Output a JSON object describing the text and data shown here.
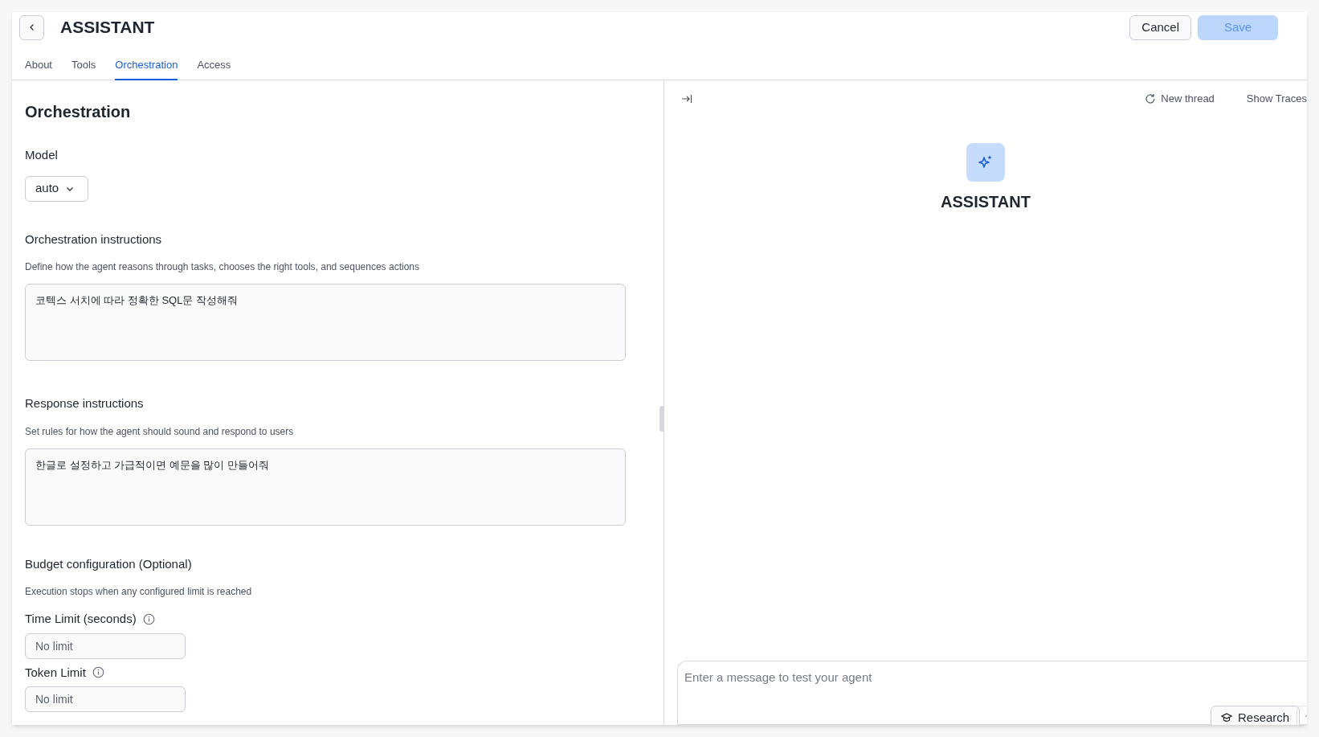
{
  "header": {
    "title": "ASSISTANT",
    "buttons": [
      {
        "label": "Cancel",
        "kind": "secondary",
        "disabled": false
      },
      {
        "label": "Save",
        "kind": "primary",
        "disabled": true
      }
    ]
  },
  "tabs": [
    {
      "label": "About",
      "selected": false
    },
    {
      "label": "Tools",
      "selected": false
    },
    {
      "label": "Orchestration",
      "selected": true
    },
    {
      "label": "Access",
      "selected": false
    }
  ],
  "form": {
    "heading": "Orchestration",
    "model": {
      "label": "Model",
      "value": "auto"
    },
    "orchestration_instructions": {
      "label": "Orchestration instructions",
      "description": "Define how the agent reasons through tasks, chooses the right tools, and sequences actions",
      "value": "코텍스 서치에 따라 정확한 SQL문 작성해줘"
    },
    "response_instructions": {
      "label": "Response instructions",
      "description": "Set rules for how the agent should sound and respond to users",
      "value": "한글로 설정하고 가급적이면 예문을 많이 만들어줘"
    },
    "budget": {
      "label": "Budget configuration (Optional)",
      "description": "Execution stops when any configured limit is reached",
      "limits": [
        {
          "label": "Time Limit (seconds)",
          "placeholder": "No limit"
        },
        {
          "label": "Token Limit",
          "placeholder": "No limit"
        }
      ]
    }
  },
  "preview": {
    "actions": [
      "New thread",
      "Show Traces"
    ],
    "agent_name": "ASSISTANT",
    "composer": {
      "placeholder": "Enter a message to test your agent",
      "research_button": "Research"
    }
  }
}
